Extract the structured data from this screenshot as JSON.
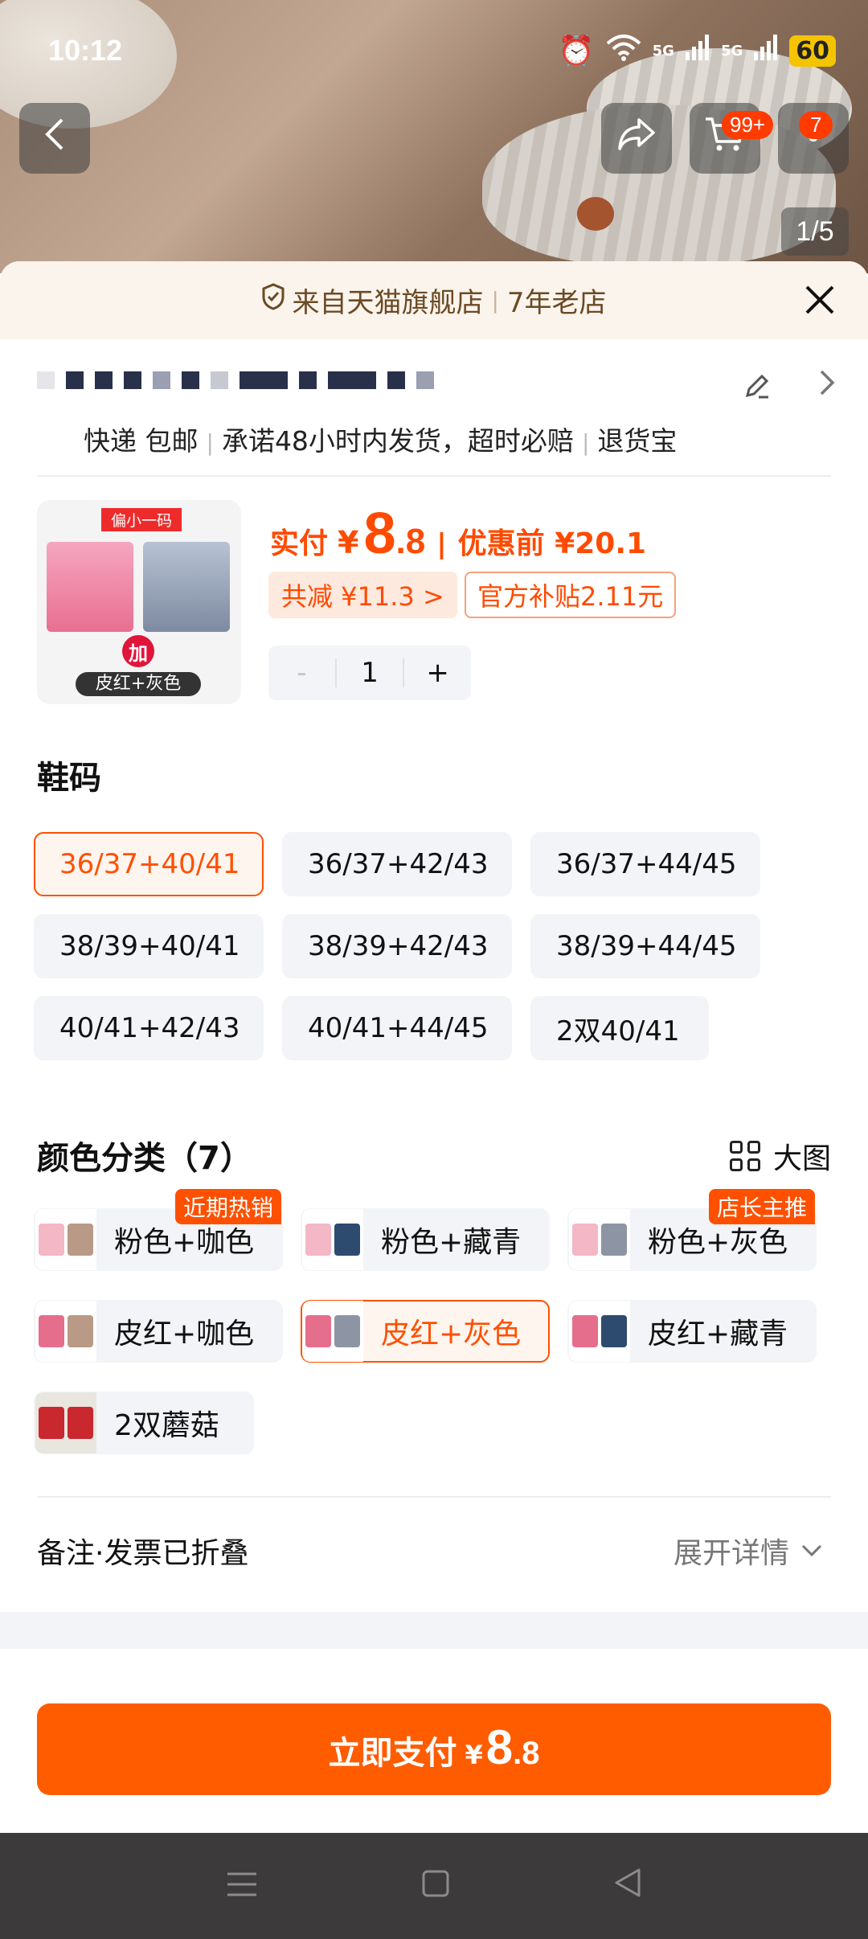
{
  "status": {
    "time": "10:12",
    "battery": "60",
    "signal1": "5G",
    "signal2": "5G"
  },
  "header": {
    "cart_badge": "99+",
    "msg_badge": "7",
    "page_indicator": "1/5"
  },
  "store": {
    "source": "来自天猫旗舰店",
    "years": "7年老店"
  },
  "shipping": {
    "items": [
      "快递 包邮",
      "承诺48小时内发货，超时必赔",
      "退货宝"
    ]
  },
  "product": {
    "thumb_tag": "偏小一码",
    "thumb_caption": "皮红+灰色",
    "thumb_plus": "加",
    "pay_label": "实付",
    "yen": "¥",
    "price_int": "8",
    "price_dec": ".8",
    "sep": "|",
    "original": "优惠前 ¥20.1",
    "reduce": "共减 ¥11.3 >",
    "subsidy": "官方补贴2.11元",
    "qty": "1",
    "minus": "-",
    "plus": "+"
  },
  "sizes": {
    "title": "鞋码",
    "options": [
      "36/37+40/41",
      "36/37+42/43",
      "36/37+44/45",
      "38/39+40/41",
      "38/39+42/43",
      "38/39+44/45",
      "40/41+42/43",
      "40/41+44/45",
      "2双40/41"
    ],
    "selected": 0
  },
  "colors": {
    "title": "颜色分类（7）",
    "big_pic": "大图",
    "options": [
      {
        "label": "粉色+咖色",
        "tag": "近期热销",
        "c1": "#f3b7c6",
        "c2": "#b89a86"
      },
      {
        "label": "粉色+藏青",
        "tag": "",
        "c1": "#f3b7c6",
        "c2": "#2d4b6e"
      },
      {
        "label": "粉色+灰色",
        "tag": "店长主推",
        "c1": "#f3b7c6",
        "c2": "#8d95a4"
      },
      {
        "label": "皮红+咖色",
        "tag": "",
        "c1": "#e56e8d",
        "c2": "#b89a86"
      },
      {
        "label": "皮红+灰色",
        "tag": "",
        "c1": "#e56e8d",
        "c2": "#8d95a4"
      },
      {
        "label": "皮红+藏青",
        "tag": "",
        "c1": "#e56e8d",
        "c2": "#2d4b6e"
      },
      {
        "label": "2双蘑菇",
        "tag": "",
        "c1": "#c9282f",
        "c2": "#c9282f"
      }
    ],
    "selected": 4
  },
  "remark": {
    "label": "备注·发票已折叠",
    "expand": "展开详情"
  },
  "pay": {
    "label": "立即支付",
    "yen": "¥",
    "int": "8",
    "dec": ".8"
  },
  "colors_theme": {
    "accent": "#ff5000",
    "price": "#ff4a00"
  }
}
